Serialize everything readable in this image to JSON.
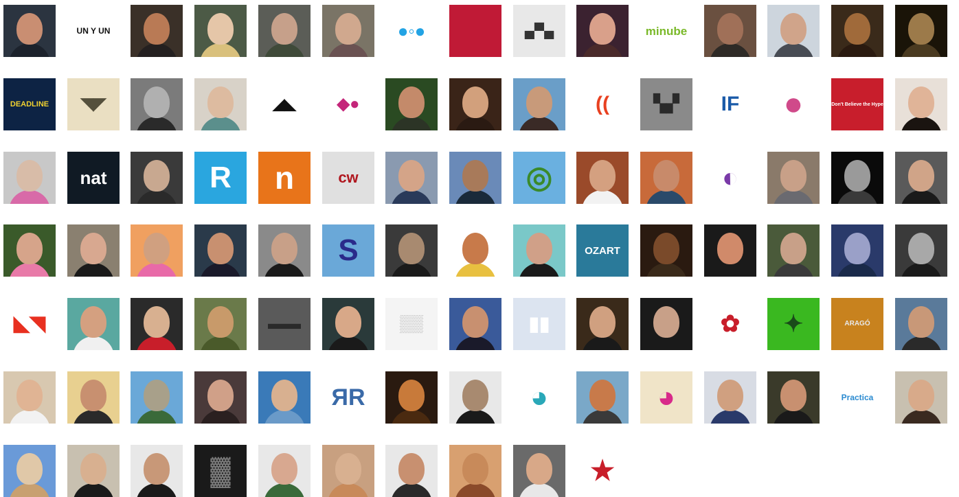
{
  "gallery": {
    "rows": [
      [
        {
          "kind": "photo",
          "bg": "#2b3440",
          "skin": "#c98e72",
          "cloth": "#1c222c"
        },
        {
          "kind": "logo",
          "bg": "#ffffff",
          "text": "UN Y UN",
          "fg": "#111111",
          "size": 12
        },
        {
          "kind": "photo",
          "bg": "#3a3028",
          "skin": "#b97a55",
          "cloth": "#242020"
        },
        {
          "kind": "photo",
          "bg": "#4c5a46",
          "skin": "#e5c6a8",
          "cloth": "#d9c07c"
        },
        {
          "kind": "photo",
          "bg": "#5b5d57",
          "skin": "#c6a08a",
          "cloth": "#3f4a39"
        },
        {
          "kind": "photo",
          "bg": "#7a7466",
          "skin": "#d0a88e",
          "cloth": "#6a5252"
        },
        {
          "kind": "logo",
          "bg": "#ffffff",
          "text": "●◦●",
          "fg": "#23a3e4",
          "size": 26
        },
        {
          "kind": "logo",
          "bg": "#c01a36",
          "text": "",
          "fg": "#ffffff",
          "size": 10
        },
        {
          "kind": "logo",
          "bg": "#e8e8e8",
          "text": "▄▀▄",
          "fg": "#333333",
          "size": 20
        },
        {
          "kind": "photo",
          "bg": "#3b2230",
          "skin": "#d9a08a",
          "cloth": "#4a2a2a"
        },
        {
          "kind": "logo",
          "bg": "#ffffff",
          "text": "minube",
          "fg": "#7ab929",
          "size": 17
        },
        {
          "kind": "photo",
          "bg": "#6a5040",
          "skin": "#a07058",
          "cloth": "#2e2a26"
        },
        {
          "kind": "photo",
          "bg": "#cdd5dd",
          "skin": "#d0a48a",
          "cloth": "#484c54"
        },
        {
          "kind": "photo",
          "bg": "#3a2a1a",
          "skin": "#a06a3a",
          "cloth": "#2a1a10"
        },
        {
          "kind": "photo",
          "bg": "#1a1408",
          "skin": "#9c7a4a",
          "cloth": "#4a3a20"
        }
      ],
      [
        {
          "kind": "logo",
          "bg": "#0d2344",
          "text": "DEADLINE",
          "fg": "#f2d230",
          "size": 11
        },
        {
          "kind": "logo",
          "bg": "#eadfc2",
          "text": "◥◤",
          "fg": "#55503c",
          "size": 24
        },
        {
          "kind": "photo",
          "bg": "#7b7b7b",
          "skin": "#b0b0b0",
          "cloth": "#2a2a2a"
        },
        {
          "kind": "photo",
          "bg": "#d8d2c8",
          "skin": "#ddbba0",
          "cloth": "#5b8f8c"
        },
        {
          "kind": "logo",
          "bg": "#ffffff",
          "text": "◢◣",
          "fg": "#111111",
          "size": 22
        },
        {
          "kind": "logo",
          "bg": "#ffffff",
          "text": "◆●",
          "fg": "#c4267a",
          "size": 24
        },
        {
          "kind": "photo",
          "bg": "#2a4a22",
          "skin": "#c48a6a",
          "cloth": "#2c3426"
        },
        {
          "kind": "photo",
          "bg": "#3a2418",
          "skin": "#d2a07c",
          "cloth": "#2a1a12"
        },
        {
          "kind": "photo",
          "bg": "#6a9ec8",
          "skin": "#c89a7a",
          "cloth": "#3a2a26"
        },
        {
          "kind": "logo",
          "bg": "#ffffff",
          "text": "((",
          "fg": "#e84020",
          "size": 30
        },
        {
          "kind": "logo",
          "bg": "#8a8a8a",
          "text": "▚▞",
          "fg": "#2a2a2a",
          "size": 24
        },
        {
          "kind": "logo",
          "bg": "#ffffff",
          "text": "IF",
          "fg": "#1a5aa8",
          "size": 30
        },
        {
          "kind": "logo",
          "bg": "#ffffff",
          "text": "●",
          "fg": "#d04a8a",
          "size": 48
        },
        {
          "kind": "logo",
          "bg": "#c81e2c",
          "text": "Don't Believe the Hype",
          "fg": "#ffffff",
          "size": 7
        },
        {
          "kind": "photo",
          "bg": "#e8e0d8",
          "skin": "#e0b498",
          "cloth": "#1a1410"
        }
      ],
      [
        {
          "kind": "photo",
          "bg": "#c8c8c8",
          "skin": "#d8bca8",
          "cloth": "#d86aa8"
        },
        {
          "kind": "logo",
          "bg": "#101a24",
          "text": "nat",
          "fg": "#ffffff",
          "size": 26
        },
        {
          "kind": "photo",
          "bg": "#3a3a3a",
          "skin": "#c8a890",
          "cloth": "#2a2a2a"
        },
        {
          "kind": "logo",
          "bg": "#2aa6df",
          "text": "R",
          "fg": "#ffffff",
          "size": 44
        },
        {
          "kind": "logo",
          "bg": "#e8741a",
          "text": "n",
          "fg": "#ffffff",
          "size": 46
        },
        {
          "kind": "logo",
          "bg": "#e0e0e0",
          "text": "cw",
          "fg": "#b01820",
          "size": 22
        },
        {
          "kind": "photo",
          "bg": "#8a9ab0",
          "skin": "#d4a488",
          "cloth": "#2a3a5a"
        },
        {
          "kind": "photo",
          "bg": "#6a8ab8",
          "skin": "#a87a5a",
          "cloth": "#1a2a3a"
        },
        {
          "kind": "logo",
          "bg": "#6ab0e0",
          "text": "◎",
          "fg": "#3a8a2a",
          "size": 44
        },
        {
          "kind": "photo",
          "bg": "#9a4a2a",
          "skin": "#d4a080",
          "cloth": "#f2f2f2"
        },
        {
          "kind": "photo",
          "bg": "#c86a3a",
          "skin": "#c88a6a",
          "cloth": "#2a4a6a"
        },
        {
          "kind": "logo",
          "bg": "#ffffff",
          "text": "◐",
          "fg": "#7a3aa8",
          "size": 40
        },
        {
          "kind": "photo",
          "bg": "#8a7a6a",
          "skin": "#c8a088",
          "cloth": "#6a6a70"
        },
        {
          "kind": "photo",
          "bg": "#0a0a0a",
          "skin": "#9a9a9a",
          "cloth": "#3a3a3a"
        },
        {
          "kind": "photo",
          "bg": "#5a5a5a",
          "skin": "#d0a488",
          "cloth": "#1a1a1a"
        }
      ],
      [
        {
          "kind": "photo",
          "bg": "#3a5a2a",
          "skin": "#d6a48a",
          "cloth": "#e87aa8"
        },
        {
          "kind": "photo",
          "bg": "#8a8070",
          "skin": "#d8a890",
          "cloth": "#1a1a1a"
        },
        {
          "kind": "photo",
          "bg": "#f0a060",
          "skin": "#d0a080",
          "cloth": "#e86aa8"
        },
        {
          "kind": "photo",
          "bg": "#2a3a4a",
          "skin": "#c89070",
          "cloth": "#1a1a2a"
        },
        {
          "kind": "photo",
          "bg": "#8a8a8a",
          "skin": "#c8a088",
          "cloth": "#1a1a1a"
        },
        {
          "kind": "logo",
          "bg": "#6aa8d8",
          "text": "S",
          "fg": "#2a2a8a",
          "size": 44
        },
        {
          "kind": "photo",
          "bg": "#3a3a3a",
          "skin": "#a88a70",
          "cloth": "#1a1a1a"
        },
        {
          "kind": "photo",
          "bg": "#ffffff",
          "skin": "#c87a4a",
          "cloth": "#e8c040"
        },
        {
          "kind": "photo",
          "bg": "#7ac8c8",
          "skin": "#d0a088",
          "cloth": "#1a1a1a"
        },
        {
          "kind": "logo",
          "bg": "#2a7a9a",
          "text": "OZART",
          "fg": "#ffffff",
          "size": 15
        },
        {
          "kind": "photo",
          "bg": "#2a1a10",
          "skin": "#7a4a2a",
          "cloth": "#3a2a1a"
        },
        {
          "kind": "photo",
          "bg": "#1a1a1a",
          "skin": "#d08a6a",
          "cloth": "#1a1a1a"
        },
        {
          "kind": "photo",
          "bg": "#4a5a3a",
          "skin": "#c8a088",
          "cloth": "#3a3a3a"
        },
        {
          "kind": "photo",
          "bg": "#2a3a6a",
          "skin": "#9aa0c8",
          "cloth": "#1a2a4a"
        },
        {
          "kind": "photo",
          "bg": "#3a3a3a",
          "skin": "#a8a8a8",
          "cloth": "#1a1a1a"
        }
      ],
      [
        {
          "kind": "logo",
          "bg": "#ffffff",
          "text": "◣◥",
          "fg": "#e83020",
          "size": 30
        },
        {
          "kind": "photo",
          "bg": "#5aa8a0",
          "skin": "#d4a080",
          "cloth": "#f0f0f0"
        },
        {
          "kind": "photo",
          "bg": "#2a2a2a",
          "skin": "#d8b090",
          "cloth": "#c81e2a"
        },
        {
          "kind": "photo",
          "bg": "#6a7a4a",
          "skin": "#c89a6a",
          "cloth": "#4a5a2a"
        },
        {
          "kind": "logo",
          "bg": "#5a5a5a",
          "text": "▬▬",
          "fg": "#2a2a2a",
          "size": 24
        },
        {
          "kind": "photo",
          "bg": "#2a3a3a",
          "skin": "#d8a888",
          "cloth": "#1a1a1a"
        },
        {
          "kind": "logo",
          "bg": "#f4f4f4",
          "text": "▒▒",
          "fg": "#b8b8b8",
          "size": 24
        },
        {
          "kind": "photo",
          "bg": "#3a5a9a",
          "skin": "#c89070",
          "cloth": "#1a1a2a"
        },
        {
          "kind": "logo",
          "bg": "#dce4f0",
          "text": "▮▮",
          "fg": "#ffffff",
          "size": 28
        },
        {
          "kind": "photo",
          "bg": "#3a2a1a",
          "skin": "#d0a080",
          "cloth": "#1a1a1a"
        },
        {
          "kind": "photo",
          "bg": "#1a1a1a",
          "skin": "#c8a088",
          "cloth": "#1a1a1a"
        },
        {
          "kind": "logo",
          "bg": "#ffffff",
          "text": "✿",
          "fg": "#c81e2a",
          "size": 34
        },
        {
          "kind": "logo",
          "bg": "#3ab820",
          "text": "✦",
          "fg": "#1a4a1a",
          "size": 34
        },
        {
          "kind": "logo",
          "bg": "#c8821e",
          "text": "ARAGÓ",
          "fg": "#e8e8e8",
          "size": 10
        },
        {
          "kind": "photo",
          "bg": "#5a7a9a",
          "skin": "#c89878",
          "cloth": "#2a2a2a"
        }
      ],
      [
        {
          "kind": "photo",
          "bg": "#d8c8b0",
          "skin": "#e0b494",
          "cloth": "#f2f2f2"
        },
        {
          "kind": "photo",
          "bg": "#e8d090",
          "skin": "#c89070",
          "cloth": "#2a2a2a"
        },
        {
          "kind": "photo",
          "bg": "#6aa8d8",
          "skin": "#a8a08a",
          "cloth": "#3a6a3a"
        },
        {
          "kind": "photo",
          "bg": "#4a3a3a",
          "skin": "#d0a088",
          "cloth": "#2a2020"
        },
        {
          "kind": "photo",
          "bg": "#3a7ab8",
          "skin": "#d8b090",
          "cloth": "#6a9ac8"
        },
        {
          "kind": "logo",
          "bg": "#ffffff",
          "text": "ЯR",
          "fg": "#3a6aa8",
          "size": 34
        },
        {
          "kind": "photo",
          "bg": "#2a1a10",
          "skin": "#c87a3a",
          "cloth": "#4a2a10"
        },
        {
          "kind": "photo",
          "bg": "#e8e8e8",
          "skin": "#a88a70",
          "cloth": "#1a1a1a"
        },
        {
          "kind": "logo",
          "bg": "#ffffff",
          "text": "◕",
          "fg": "#2aa8b8",
          "size": 44
        },
        {
          "kind": "photo",
          "bg": "#7aa8c8",
          "skin": "#c87a4a",
          "cloth": "#3a3a3a"
        },
        {
          "kind": "logo",
          "bg": "#f0e4c8",
          "text": "◕",
          "fg": "#d82a8a",
          "size": 44
        },
        {
          "kind": "photo",
          "bg": "#d8dce4",
          "skin": "#d0a080",
          "cloth": "#2a3a6a"
        },
        {
          "kind": "photo",
          "bg": "#3a3a2a",
          "skin": "#c89070",
          "cloth": "#1a1a1a"
        },
        {
          "kind": "logo",
          "bg": "#ffffff",
          "text": "Practica",
          "fg": "#2a8ad0",
          "size": 12
        },
        {
          "kind": "photo",
          "bg": "#c8c0b0",
          "skin": "#d8aa8a",
          "cloth": "#3a2a20"
        }
      ],
      [
        {
          "kind": "photo",
          "bg": "#6a9ad8",
          "skin": "#e0c8a8",
          "cloth": "#c8a070"
        },
        {
          "kind": "photo",
          "bg": "#c8c0b0",
          "skin": "#d8b090",
          "cloth": "#1a1a1a"
        },
        {
          "kind": "photo",
          "bg": "#e8e8e8",
          "skin": "#c89878",
          "cloth": "#1a1a1a"
        },
        {
          "kind": "logo",
          "bg": "#1a1a1a",
          "text": "▓",
          "fg": "#7a7a7a",
          "size": 40
        },
        {
          "kind": "photo",
          "bg": "#e8e8e8",
          "skin": "#d8a890",
          "cloth": "#3a6a3a"
        },
        {
          "kind": "photo",
          "bg": "#c8a080",
          "skin": "#d8b090",
          "cloth": "#c88a5a"
        },
        {
          "kind": "photo",
          "bg": "#e8e8e8",
          "skin": "#c89070",
          "cloth": "#2a2a2a"
        },
        {
          "kind": "photo",
          "bg": "#d8a070",
          "skin": "#c88a5a",
          "cloth": "#8a4a2a"
        },
        {
          "kind": "photo",
          "bg": "#6a6a6a",
          "skin": "#d8a888",
          "cloth": "#e8e8e8"
        },
        {
          "kind": "logo",
          "bg": "#ffffff",
          "text": "★",
          "fg": "#c81e2a",
          "size": 40
        }
      ]
    ]
  }
}
